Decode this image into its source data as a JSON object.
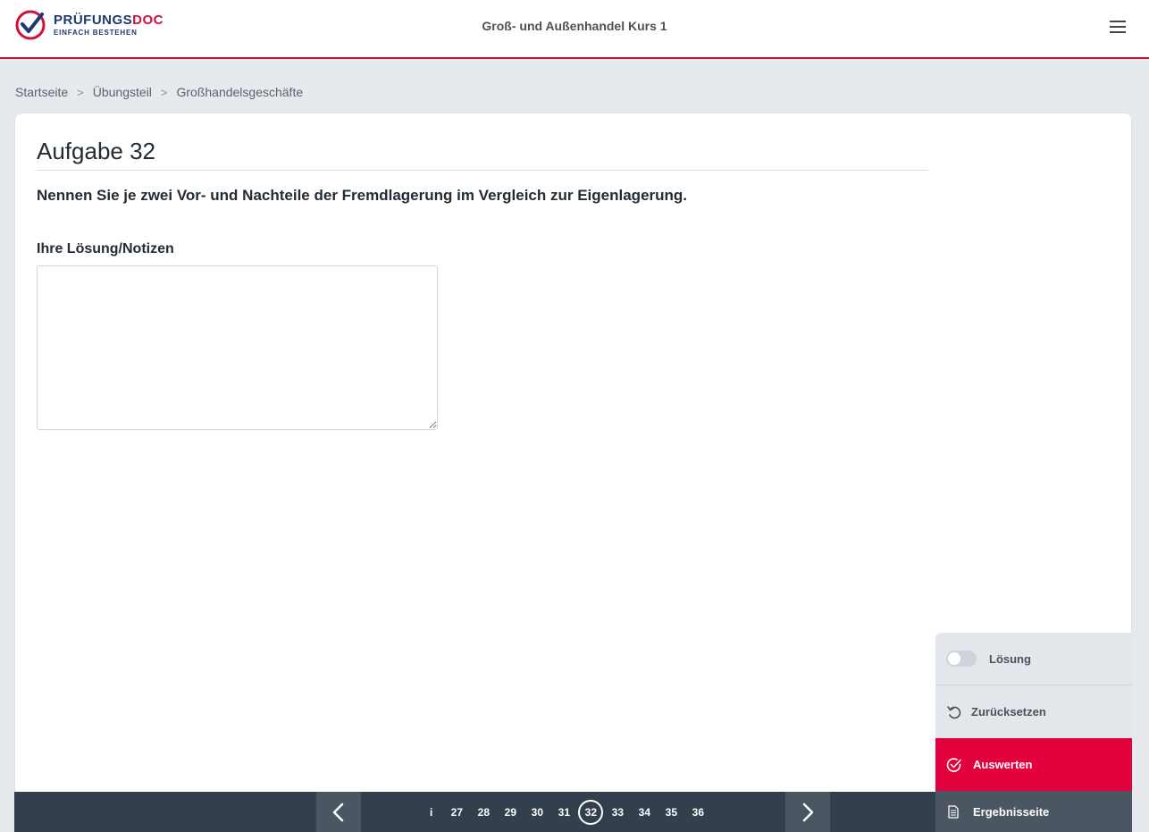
{
  "brand": {
    "name_part1": "PRÜFUNGS",
    "name_part2": "DOC",
    "tagline": "EINFACH BESTEHEN",
    "primary_color": "#1d3a6e",
    "accent_color": "#d0103a"
  },
  "header": {
    "title": "Groß- und Außenhandel Kurs 1",
    "menu_icon": "hamburger-menu-icon"
  },
  "breadcrumb": {
    "items": [
      "Startseite",
      "Übungsteil",
      "Großhandelsgeschäfte"
    ],
    "separator": ">"
  },
  "task": {
    "title": "Aufgabe 32",
    "question": "Nennen Sie je zwei Vor- und Nachteile der Fremdlagerung im Vergleich zur Eigenlagerung.",
    "notes_label": "Ihre Lösung/Notizen",
    "notes_value": ""
  },
  "pager": {
    "prev_icon": "chevron-left-icon",
    "next_icon": "chevron-right-icon",
    "truncated_marker": "i",
    "pages": [
      "27",
      "28",
      "29",
      "30",
      "31",
      "32",
      "33",
      "34",
      "35",
      "36"
    ],
    "current_page": "32",
    "bar_color": "#333f4c"
  },
  "side_panel": {
    "toggle_label": "Lösung",
    "toggle_on": false,
    "reset_label": "Zurücksetzen",
    "evaluate_label": "Auswerten",
    "results_label": "Ergebnisseite",
    "evaluate_color": "#e2003d"
  }
}
